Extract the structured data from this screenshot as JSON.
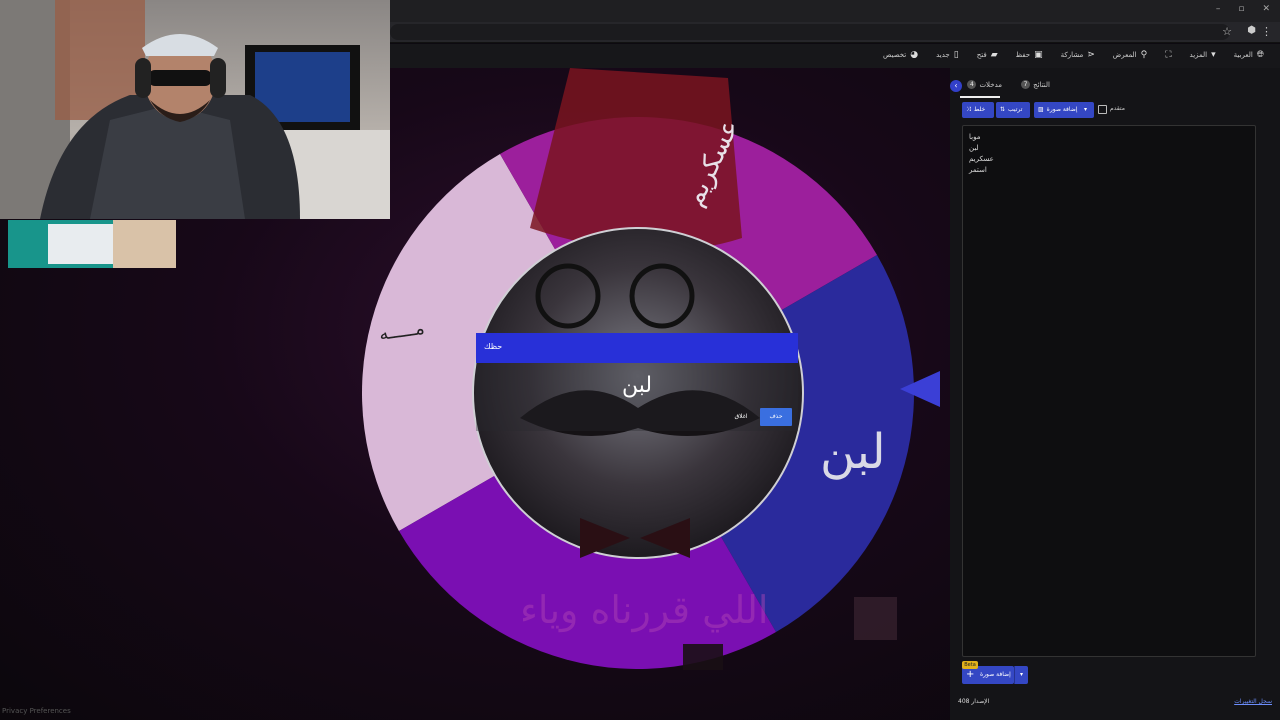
{
  "toolbar": {
    "customize": "تخصيص",
    "new": "جديد",
    "open": "فتح",
    "save": "حفظ",
    "share": "مشاركة",
    "gallery": "المعرض",
    "more": "المزيد",
    "language": "العربية"
  },
  "wheel": {
    "colors": {
      "light": "#d9b8d7",
      "magenta": "#9c1f9c",
      "purple": "#7a0fb2",
      "blue": "#2a2a9c"
    },
    "labels": {
      "icecream": "عسكريم",
      "laban": "لبن",
      "watermark": "اللي قررناه وياء"
    }
  },
  "dialog": {
    "title": "حظك",
    "winner": "لبن",
    "remove_label": "حذف",
    "close_label": "اغلاق"
  },
  "panel": {
    "tabs": {
      "entries_label": "مدخلات",
      "entries_count": "4",
      "results_label": "النتائج",
      "results_count": "7"
    },
    "tools": {
      "shuffle": "خلط",
      "sort": "ترتيب",
      "add_image": "إضافة صورة",
      "advanced": "متقدم"
    },
    "entries": [
      "موبا",
      "لبن",
      "عسكريم",
      "استمر"
    ],
    "beta": "Beta",
    "add_image_bottom": "إضافة صورة",
    "version": "الإصدار 408",
    "changelog": "سجل التغييرات"
  },
  "footer": {
    "privacy": "Privacy Preferences"
  },
  "window": {
    "minimize": "–",
    "restore": "▫",
    "close": "✕"
  }
}
